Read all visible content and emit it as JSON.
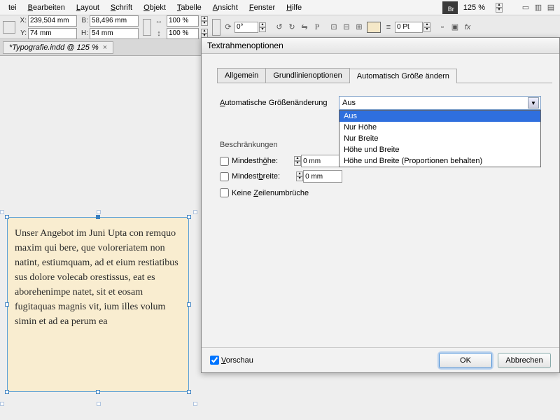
{
  "menu": {
    "items": [
      "tei",
      "Bearbeiten",
      "Layout",
      "Schrift",
      "Objekt",
      "Tabelle",
      "Ansicht",
      "Fenster",
      "Hilfe"
    ],
    "zoom": "125 %"
  },
  "toolbar": {
    "x": "239,504 mm",
    "y": "74 mm",
    "w": "58,496 mm",
    "h": "54 mm",
    "scale_x": "100 %",
    "scale_y": "100 %",
    "rotate": "0°",
    "stroke": "0 Pt"
  },
  "doctab": {
    "name": "*Typografie.indd @ 125 %",
    "close": "×"
  },
  "textframe": {
    "body": "Unser Angebot im Juni Upta con remquo maxim qui bere, que voloreriatem non natint, estiumquam, ad et eium resti­atibus sus dolore volecab ore­stissus, eat es aborehenimpe natet, sit et eosam fugitaquas magnis vit, ium illes volum simin et ad ea perum ea"
  },
  "dialog": {
    "title": "Textrahmenoptionen",
    "tabs": [
      "Allgemein",
      "Grundlinienoptionen",
      "Automatisch Größe ändern"
    ],
    "active_tab": 2,
    "autosize_label": "Automatische Größenänderung",
    "autosize_value": "Aus",
    "autosize_options": [
      "Aus",
      "Nur Höhe",
      "Nur Breite",
      "Höhe und Breite",
      "Höhe und Breite (Proportionen behalten)"
    ],
    "constraints_title": "Beschränkungen",
    "min_height_label": "Mindesthöhe:",
    "min_height_value": "0 mm",
    "min_width_label": "Mindestbreite:",
    "min_width_value": "0 mm",
    "no_breaks_label": "Keine Zeilenumbrüche",
    "preview_label": "Vorschau",
    "ok": "OK",
    "cancel": "Abbrechen"
  }
}
